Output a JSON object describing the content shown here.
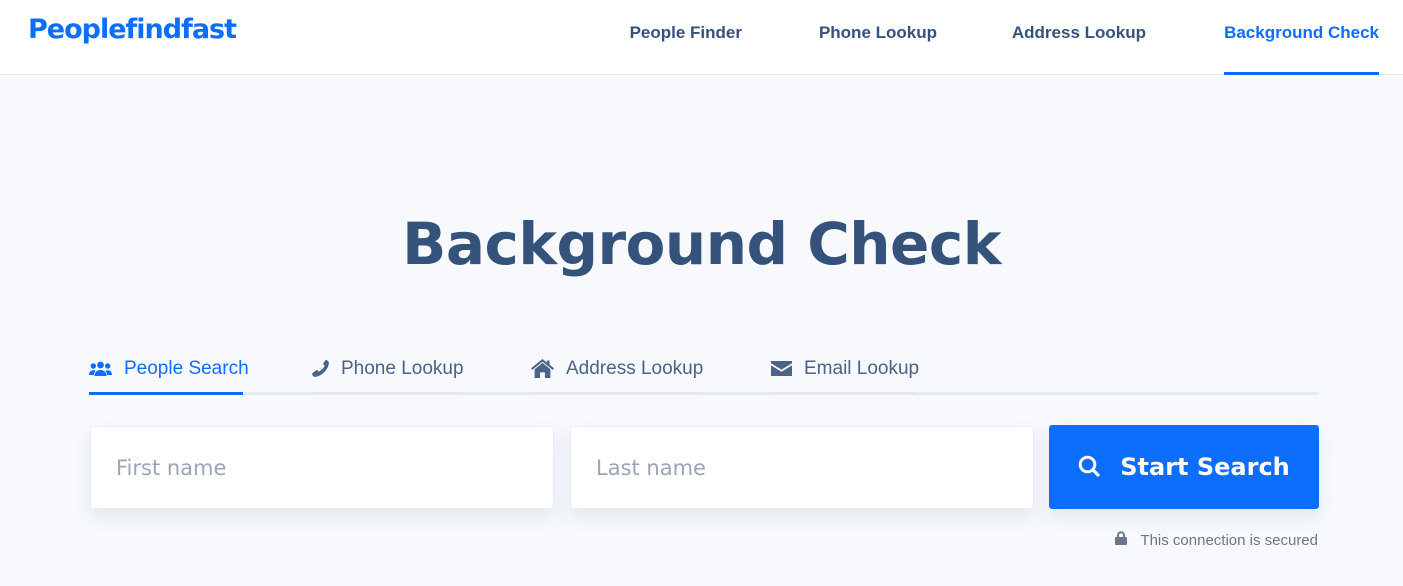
{
  "header": {
    "logo": "Peoplefindfast",
    "nav": [
      {
        "label": "People Finder",
        "active": false
      },
      {
        "label": "Phone Lookup",
        "active": false
      },
      {
        "label": "Address Lookup",
        "active": false
      },
      {
        "label": "Background Check",
        "active": true
      }
    ]
  },
  "main": {
    "title": "Background Check",
    "tabs": [
      {
        "label": "People Search",
        "icon": "users-icon",
        "active": true
      },
      {
        "label": "Phone Lookup",
        "icon": "phone-icon",
        "active": false
      },
      {
        "label": "Address Lookup",
        "icon": "home-icon",
        "active": false
      },
      {
        "label": "Email Lookup",
        "icon": "envelope-icon",
        "active": false
      }
    ],
    "form": {
      "first_name": {
        "value": "",
        "placeholder": "First name"
      },
      "last_name": {
        "value": "",
        "placeholder": "Last name"
      },
      "submit_label": "Start Search",
      "submit_icon": "search-icon"
    },
    "security_note": {
      "icon": "lock-icon",
      "text": "This connection is secured"
    }
  },
  "colors": {
    "accent": "#0d6efd",
    "heading": "#34527a",
    "background": "#f7f9fd"
  }
}
